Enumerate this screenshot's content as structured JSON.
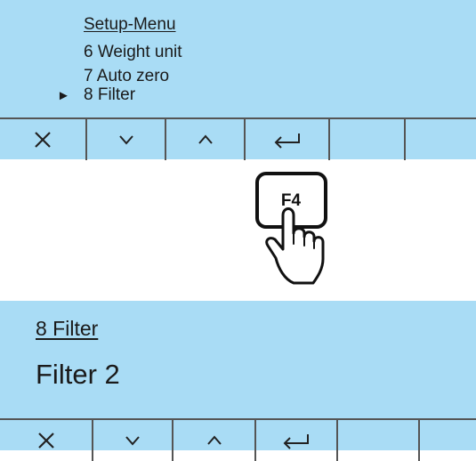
{
  "screen1": {
    "title": "Setup-Menu",
    "items": [
      {
        "label": "6 Weight unit"
      },
      {
        "label": "7 Auto zero"
      },
      {
        "label": "8 Filter"
      }
    ],
    "cursor_glyph": "►"
  },
  "softkeys_icons": [
    "close-icon",
    "chevron-down-icon",
    "chevron-up-icon",
    "enter-icon",
    "blank",
    "blank"
  ],
  "press": {
    "key_label": "F4"
  },
  "screen2": {
    "title": "8 Filter",
    "value": "Filter 2"
  },
  "colors": {
    "lcd_background": "#a9dcf5",
    "line": "#555555",
    "text": "#1a1a1a"
  }
}
